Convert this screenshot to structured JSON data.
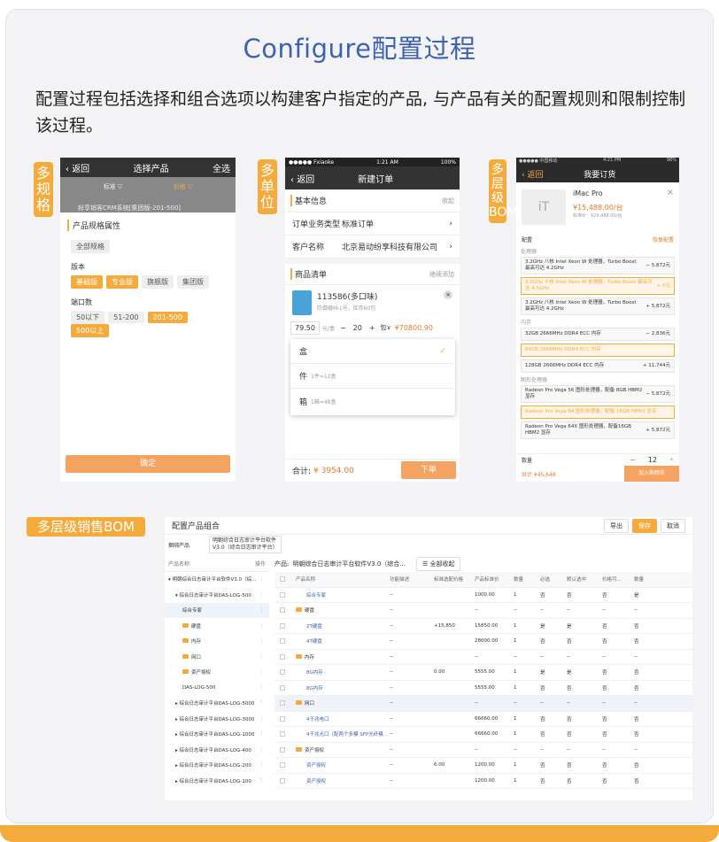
{
  "page": {
    "title": "Configure配置过程",
    "intro": "配置过程包括选择和组合选项以构建客户指定的产品, 与产品有关的配置规则和限制控制该过程。"
  },
  "tags": {
    "spec": "多规格",
    "unit": "多单位",
    "bom": "多层级BOM",
    "bom_sales": "多层级销售BOM"
  },
  "phone1": {
    "back": "返回",
    "title": "选择产品",
    "all": "全选",
    "filter1": "标准 ▽",
    "filter2": "价格 ▽",
    "item": "纷享销客CRM系统[集团版-201-500]",
    "attr_title": "产品规格属性",
    "all_spec": "全部规格",
    "version_label": "版本",
    "versions": [
      "基础版",
      "专业版",
      "旗舰版",
      "集团版"
    ],
    "ports_label": "端口数",
    "ports": [
      "50以下",
      "51-200",
      "201-500",
      "500以上"
    ],
    "confirm": "确定"
  },
  "phone2": {
    "carrier": "●●●●● Fxiaoke ",
    "time": "1:21 AM",
    "battery": "100%",
    "back": "返回",
    "title": "新建订单",
    "basic": "基本信息",
    "collapse": "收起",
    "order_type_label": "订单业务类型",
    "order_type": "标准订单",
    "customer_label": "客户名称",
    "customer": "北京易动纷享科技有限公司",
    "products": "商品清单",
    "add": "继续添加",
    "product_name": "113586(多口味)",
    "product_sub": "防御器M-L号，库存60包",
    "price": "79.50",
    "price_unit": "元/盒",
    "minus": "−",
    "qty": "20",
    "plus": "+",
    "unit_sel": "包∨",
    "line_total": "¥70800.90",
    "units": [
      {
        "name": "盒",
        "conv": ""
      },
      {
        "name": "件",
        "conv": "1件=12盒"
      },
      {
        "name": "箱",
        "conv": "1箱=48盒"
      }
    ],
    "total_label": "合计:",
    "total": "¥ 3954.00",
    "submit": "下单"
  },
  "phone3": {
    "carrier": "●●●●● 中国移动 ",
    "time": "4:21 PM",
    "battery": "98%",
    "back": "返回",
    "title": "我要订货",
    "logo": "iT",
    "product": "iMac Pro",
    "price": "¥15,488.00/台",
    "sub_price": "标准价：¥29,488.00/台",
    "config_label": "配置",
    "reset": "恢复配置",
    "cpu_label": "处理器",
    "cpu": [
      {
        "name": "3.2GHz 八核 Intel Xeon W 处理器，Turbo Boost 最高可达 4.2GHz",
        "price": "− 5,872元",
        "sel": false
      },
      {
        "name": "3.0GHz 十核 Intel Xeon W 处理器，Turbo Boost 最高可达 4.5GHz",
        "price": "+ 0元",
        "sel": true
      },
      {
        "name": "3.2GHz 八核 Intel Xeon W 处理器，Turbo Boost 最高可达 4.2GHz",
        "price": "+ 5,872元",
        "sel": false
      }
    ],
    "mem_label": "内存",
    "mem": [
      {
        "name": "32GB 2666MHz DDR4 ECC 内存",
        "price": "− 2,836元",
        "sel": false
      },
      {
        "name": "64GB 2666MHz DDR4 ECC 内存",
        "price": "",
        "sel": true
      },
      {
        "name": "128GB 2666MHz DDR4 ECC 内存",
        "price": "+ 11,744元",
        "sel": false
      }
    ],
    "gpu_label": "图形处理器",
    "gpu": [
      {
        "name": "Radeon Pro Vega 56 图形处理器，配备 8GB HBM2 显存",
        "price": "− 5,872元",
        "sel": false
      },
      {
        "name": "Radeon Pro Vega 64 图形处理器，配备 16GB HBM2 显存",
        "price": "",
        "sel": true
      },
      {
        "name": "Radeon Pro Vega 64X 图形处理器，配备16GB HBM2 显存",
        "price": "+ 5,872元",
        "sel": false
      }
    ],
    "qty_label": "数量",
    "qty": "12",
    "total": "共计 ¥45,648",
    "cart": "加入购物车"
  },
  "panel": {
    "title": "配置产品组合",
    "export": "导出",
    "save": "保存",
    "cancel": "取消",
    "bundle_label": "捆绑产品",
    "bundle": "明朝综合日志审计平台软件V3.0（综合日志审计平台）",
    "tree_head": "产品名称",
    "tree_op": "操作",
    "product_label": "产品:",
    "product": "明朝综合日志审计平台软件V3.0（综合...",
    "collapse_all": "全部收起",
    "headers": [
      "产品名称",
      "功能描述",
      "标准选配价格",
      "产品标准价",
      "数量",
      "必选",
      "默认选中",
      "价格可...",
      "数量"
    ],
    "tree": [
      {
        "t": "明朝综合日志审计平台软件V3.0（综...",
        "ind": 0,
        "ar": "▾"
      },
      {
        "t": "综合日志审计平台DAS-LOG-500",
        "ind": 1,
        "ar": "▾"
      },
      {
        "t": "综合专家",
        "ind": 2,
        "ar": ""
      },
      {
        "t": "硬盘",
        "ind": 2,
        "ar": "",
        "f": true
      },
      {
        "t": "内存",
        "ind": 2,
        "ar": "",
        "f": true
      },
      {
        "t": "网口",
        "ind": 2,
        "ar": "",
        "f": true
      },
      {
        "t": "资产授权",
        "ind": 2,
        "ar": "",
        "f": true
      },
      {
        "t": "DAS-LOG-500",
        "ind": 2,
        "ar": ""
      },
      {
        "t": "综合日志审计平台DAS-LOG-5000",
        "ind": 1,
        "ar": "▸"
      },
      {
        "t": "综合日志审计平台DAS-LOG-3000",
        "ind": 1,
        "ar": "▸"
      },
      {
        "t": "综合日志审计平台DAS-LOG-1000",
        "ind": 1,
        "ar": "▸"
      },
      {
        "t": "综合日志审计平台DAS-LOG-400",
        "ind": 1,
        "ar": "▸"
      },
      {
        "t": "综合日志审计平台DAS-LOG-200",
        "ind": 1,
        "ar": "▸"
      },
      {
        "t": "综合日志审计平台DAS-LOG-100",
        "ind": 1,
        "ar": "▸"
      }
    ],
    "rows": [
      {
        "n": "综合专家",
        "d": "--",
        "p": "",
        "s": "1000.00",
        "q": "1",
        "m": "否",
        "dd": "否",
        "pc": "否",
        "qq": "是",
        "f": false,
        "ind": 1
      },
      {
        "n": "硬盘",
        "d": "--",
        "p": "",
        "s": "--",
        "q": "--",
        "m": "--",
        "dd": "--",
        "pc": "--",
        "qq": "--",
        "f": true,
        "ind": 0
      },
      {
        "n": "2T硬盘",
        "d": "--",
        "p": "+15,850",
        "s": "15850.00",
        "q": "1",
        "m": "是",
        "dd": "是",
        "pc": "否",
        "qq": "否",
        "f": false,
        "ind": 1
      },
      {
        "n": "4T硬盘",
        "d": "--",
        "p": "",
        "s": "28000.00",
        "q": "1",
        "m": "否",
        "dd": "否",
        "pc": "否",
        "qq": "否",
        "f": false,
        "ind": 1
      },
      {
        "n": "内存",
        "d": "--",
        "p": "",
        "s": "--",
        "q": "--",
        "m": "--",
        "dd": "--",
        "pc": "--",
        "qq": "--",
        "f": true,
        "ind": 0
      },
      {
        "n": "8G内存",
        "d": "--",
        "p": "0.00",
        "s": "5555.00",
        "q": "1",
        "m": "是",
        "dd": "是",
        "pc": "否",
        "qq": "否",
        "f": false,
        "ind": 1
      },
      {
        "n": "8G内存",
        "d": "--",
        "p": "",
        "s": "5555.00",
        "q": "1",
        "m": "否",
        "dd": "否",
        "pc": "否",
        "qq": "否",
        "f": false,
        "ind": 1
      },
      {
        "n": "网口",
        "d": "--",
        "p": "",
        "s": "--",
        "q": "--",
        "m": "--",
        "dd": "--",
        "pc": "--",
        "qq": "--",
        "f": true,
        "ind": 0,
        "hl": true
      },
      {
        "n": "4千兆电口",
        "d": "--",
        "p": "",
        "s": "66660.00",
        "q": "1",
        "m": "否",
        "dd": "否",
        "pc": "否",
        "qq": "否",
        "f": false,
        "ind": 1
      },
      {
        "n": "4千兆光口（配两个多模 SFP光纤模...",
        "d": "--",
        "p": "",
        "s": "66660.00",
        "q": "1",
        "m": "否",
        "dd": "否",
        "pc": "否",
        "qq": "否",
        "f": false,
        "ind": 1
      },
      {
        "n": "资产授权",
        "d": "--",
        "p": "",
        "s": "--",
        "q": "--",
        "m": "--",
        "dd": "--",
        "pc": "--",
        "qq": "--",
        "f": true,
        "ind": 0
      },
      {
        "n": "资产授权",
        "d": "--",
        "p": "6.00",
        "s": "1200.00",
        "q": "1",
        "m": "否",
        "dd": "否",
        "pc": "否",
        "qq": "否",
        "f": false,
        "ind": 1
      },
      {
        "n": "资产授权",
        "d": "--",
        "p": "",
        "s": "1200.00",
        "q": "1",
        "m": "否",
        "dd": "否",
        "pc": "否",
        "qq": "否",
        "f": false,
        "ind": 1
      }
    ]
  }
}
